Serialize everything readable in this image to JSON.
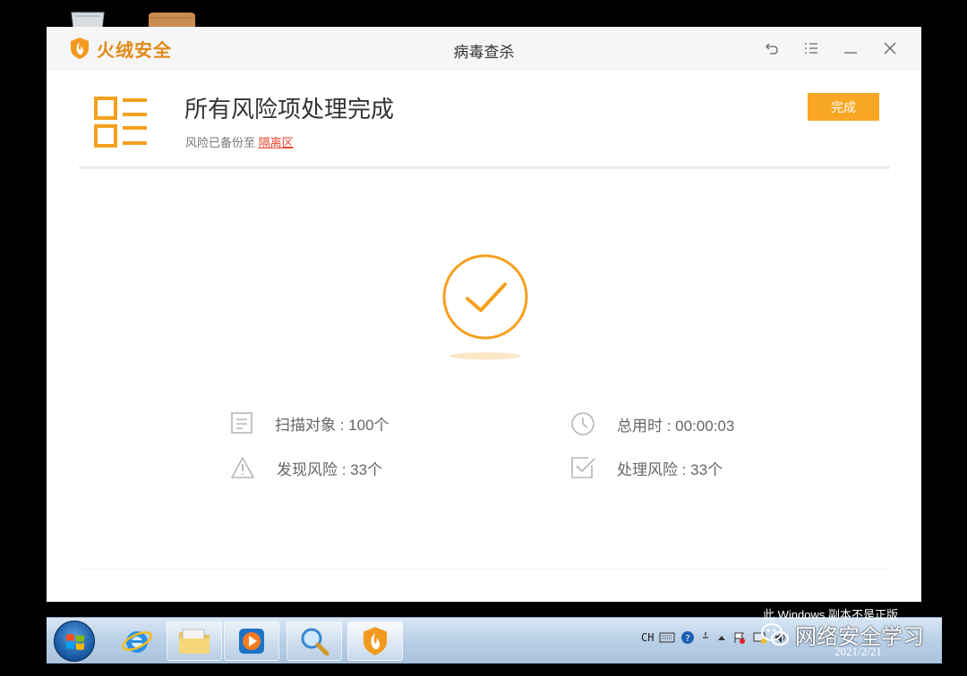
{
  "window": {
    "brand_name": "火绒安全",
    "title": "病毒查杀",
    "controls": [
      "back-icon",
      "menu-icon",
      "minimize-icon",
      "close-icon"
    ]
  },
  "result": {
    "title": "所有风险项处理完成",
    "subtitle_prefix": "风险已备份至 ",
    "subtitle_link": "隔离区",
    "done_button": "完成"
  },
  "stats": {
    "scanned": "扫描对象 : 100个",
    "elapsed": "总用时 : 00:00:03",
    "found": "发现风险 : 33个",
    "handled": "处理风险 : 33个"
  },
  "taskbar": {
    "items": [
      "start-button",
      "ie",
      "explorer",
      "media-player",
      "search",
      "huorong"
    ],
    "tray_lang": "CH",
    "clock_date": "2021/2/21"
  },
  "overlay": {
    "windows_notice": "此 Windows 副本不是正版",
    "wechat_account": "网络安全学习"
  },
  "colors": {
    "accent": "#f8a724",
    "brand": "#e28a17",
    "link": "#e8462f"
  }
}
